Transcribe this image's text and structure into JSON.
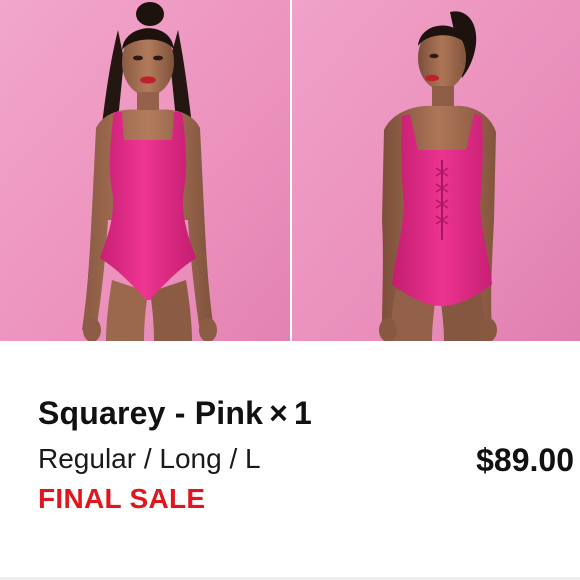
{
  "product": {
    "name": "Squarey - Pink",
    "quantity_separator": "×",
    "quantity": "1",
    "variant": "Regular / Long / L",
    "price": "$89.00",
    "status": "FINAL SALE"
  },
  "images": {
    "front": "product-photo-front",
    "back": "product-photo-back"
  },
  "colors": {
    "backdrop": "#ef9ac4",
    "garment": "#ea2f8b",
    "final_sale": "#e0161e",
    "text": "#111111"
  }
}
